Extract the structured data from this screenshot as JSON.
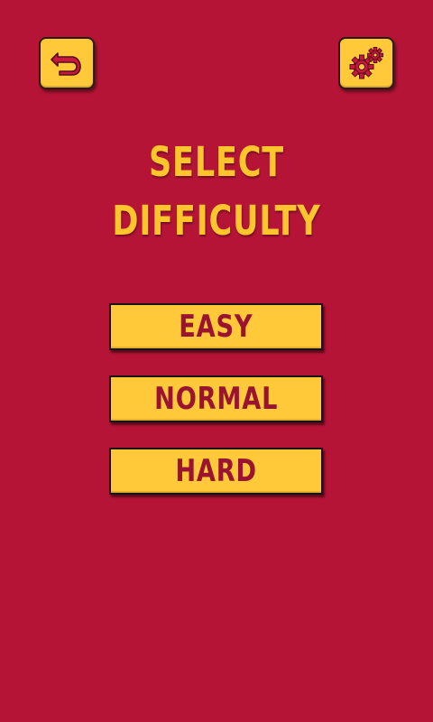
{
  "header": {
    "back_icon": "back-arrow-icon",
    "settings_icon": "gears-icon"
  },
  "title": {
    "line1": "SELECT",
    "line2": "DIFFICULTY"
  },
  "difficulty": {
    "easy_label": "EASY",
    "normal_label": "NORMAL",
    "hard_label": "HARD"
  },
  "colors": {
    "background": "#b51436",
    "button": "#ffc93a",
    "button_text": "#9a1330",
    "title_text": "#fcc52c"
  }
}
